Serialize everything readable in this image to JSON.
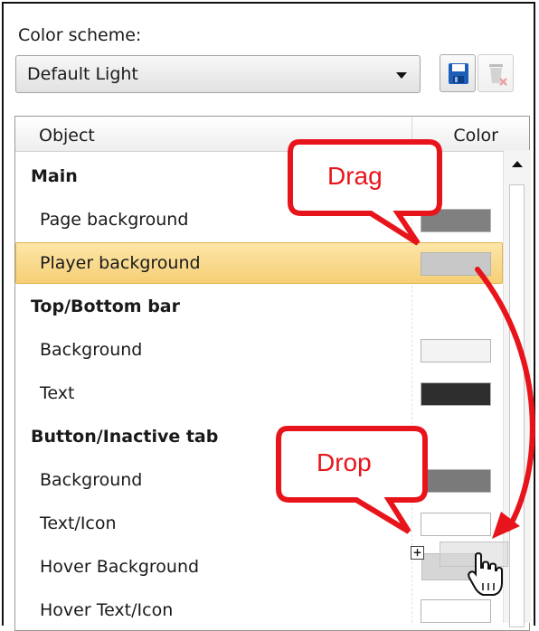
{
  "scheme": {
    "label": "Color scheme:",
    "selected": "Default Light",
    "save_icon": "save-icon",
    "delete_icon": "delete-icon"
  },
  "grid": {
    "col_object": "Object",
    "col_color": "Color",
    "rows": [
      {
        "type": "group",
        "label": "Main"
      },
      {
        "type": "item",
        "label": "Page background",
        "color": "#808080"
      },
      {
        "type": "item",
        "label": "Player background",
        "color": "#c8c8c8",
        "selected": true
      },
      {
        "type": "group",
        "label": "Top/Bottom bar"
      },
      {
        "type": "item",
        "label": "Background",
        "color": "#f3f3f3"
      },
      {
        "type": "item",
        "label": "Text",
        "color": "#2e2e2e"
      },
      {
        "type": "group",
        "label": "Button/Inactive tab"
      },
      {
        "type": "item",
        "label": "Background",
        "color": "#7a7a7a"
      },
      {
        "type": "item",
        "label": "Text/Icon",
        "color": "#ffffff"
      },
      {
        "type": "item",
        "label": "Hover Background",
        "color": "#ffffff"
      },
      {
        "type": "item",
        "label": "Hover Text/Icon",
        "color": "#ffffff"
      }
    ]
  },
  "callouts": {
    "drag": "Drag",
    "drop": "Drop",
    "color": "#e8141b"
  },
  "cursor_icon": "hand-pointer-icon"
}
